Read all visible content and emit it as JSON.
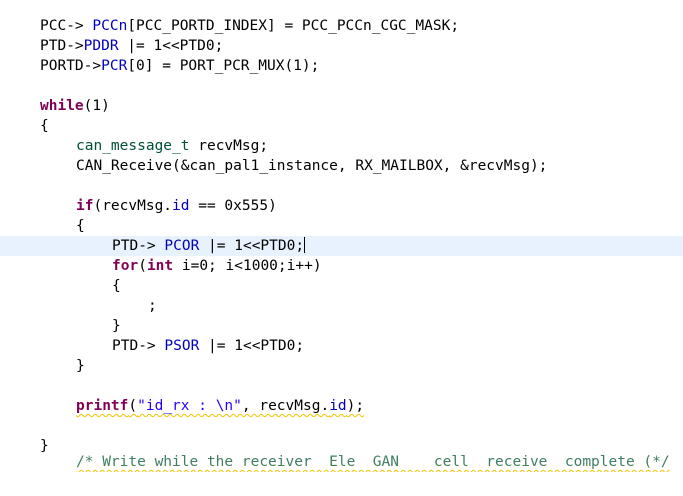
{
  "editor": {
    "l1": {
      "a": "PCC-> ",
      "b": "PCCn",
      "c": "[PCC_PORTD_INDEX] = PCC_PCCn_CGC_MASK;"
    },
    "l2": {
      "a": "PTD->",
      "b": "PDDR",
      "c": " |= 1<<PTD0;"
    },
    "l3": {
      "a": "PORTD->",
      "b": "PCR",
      "c": "[0] = PORT_PCR_MUX(1);"
    },
    "l5": {
      "kw": "while",
      "rest": "(1)"
    },
    "l6": {
      "text": "{"
    },
    "l7": {
      "type": "can_message_t",
      "rest": " recvMsg;"
    },
    "l8": {
      "text": "CAN_Receive(&can_pal1_instance, RX_MAILBOX, &recvMsg);"
    },
    "l10": {
      "kw": "if",
      "a": "(recvMsg.",
      "field": "id",
      "b": " == 0x555)"
    },
    "l11": {
      "text": "{"
    },
    "l12": {
      "a": "PTD-> ",
      "field": "PCOR",
      "b": " |= 1<<PTD0;"
    },
    "l13": {
      "kw1": "for",
      "a": "(",
      "kw2": "int",
      "b": " i=0; i<1000;i++)"
    },
    "l14": {
      "text": "{"
    },
    "l15": {
      "text": ";"
    },
    "l16": {
      "text": "}"
    },
    "l17": {
      "a": "PTD-> ",
      "field": "PSOR",
      "b": " |= 1<<PTD0;"
    },
    "l18": {
      "text": "}"
    },
    "l20": {
      "fn": "printf",
      "a": "(",
      "str": "\"id_rx : \\n\"",
      "b": ", recvMsg.",
      "field": "id",
      "c": ");"
    },
    "l22": {
      "text": "}"
    },
    "l23": {
      "text": "/* Write while the receiver  Ele  GAN    cell  receive  complete (*/"
    }
  }
}
